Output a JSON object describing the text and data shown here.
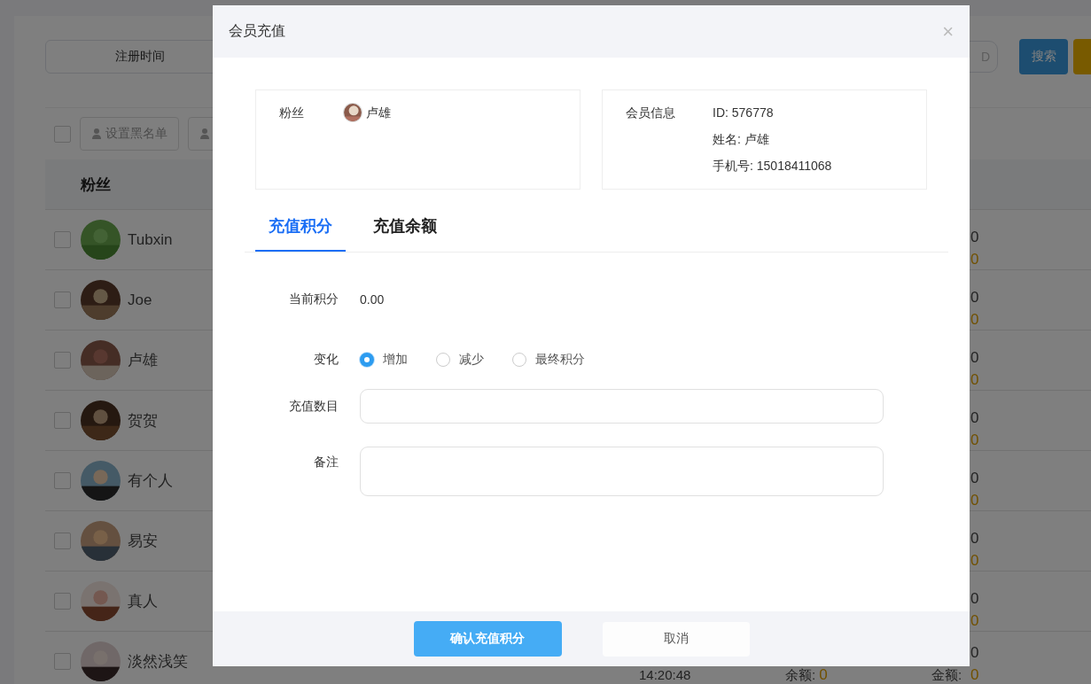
{
  "page": {
    "filter": {
      "date_label": "注册时间",
      "search_placeholder": "D",
      "search_button": "搜索"
    },
    "toolbar": {
      "checked": false,
      "buttons": [
        {
          "kind": "labeled",
          "label": "设置黑名单"
        },
        {
          "kind": "icon_only"
        }
      ]
    },
    "table": {
      "header": "粉丝",
      "rows": [
        {
          "name": "Tubxin",
          "checked": false,
          "points": "0",
          "amount": "0"
        },
        {
          "name": "Joe",
          "checked": false,
          "points": "0",
          "amount": "0"
        },
        {
          "name": "卢雄",
          "checked": false,
          "points": "0",
          "amount": "0"
        },
        {
          "name": "贺贺",
          "checked": false,
          "points": "0",
          "amount": "0"
        },
        {
          "name": "有个人",
          "checked": false,
          "points": "0",
          "amount": "0"
        },
        {
          "name": "易安",
          "checked": false,
          "points": "0",
          "amount": "0"
        },
        {
          "name": "真人",
          "checked": false,
          "points": "0",
          "amount": "0"
        },
        {
          "name": "淡然浅笑",
          "checked": false,
          "points": "0",
          "amount": "0",
          "time": "14:20:48",
          "balance_label": "余额:",
          "balance": "0",
          "amount_label": "金额:"
        }
      ]
    }
  },
  "dialog": {
    "title": "会员充值",
    "close": "×",
    "fan": {
      "label": "粉丝",
      "name": "卢雄"
    },
    "member": {
      "label": "会员信息",
      "lines": [
        "ID: 576778",
        "姓名: 卢雄",
        "手机号: 15018411068"
      ]
    },
    "tabs": [
      {
        "label": "充值积分",
        "selected": true
      },
      {
        "label": "充值余额",
        "selected": false
      }
    ],
    "form": {
      "current_label": "当前积分",
      "current_value": "0.00",
      "change_label": "变化",
      "options": [
        {
          "label": "增加",
          "selected": true
        },
        {
          "label": "减少",
          "selected": false
        },
        {
          "label": "最终积分",
          "selected": false
        }
      ],
      "amount_label": "充值数目",
      "note_label": "备注"
    },
    "buttons": {
      "confirm": "确认充值积分",
      "cancel": "取消"
    }
  }
}
